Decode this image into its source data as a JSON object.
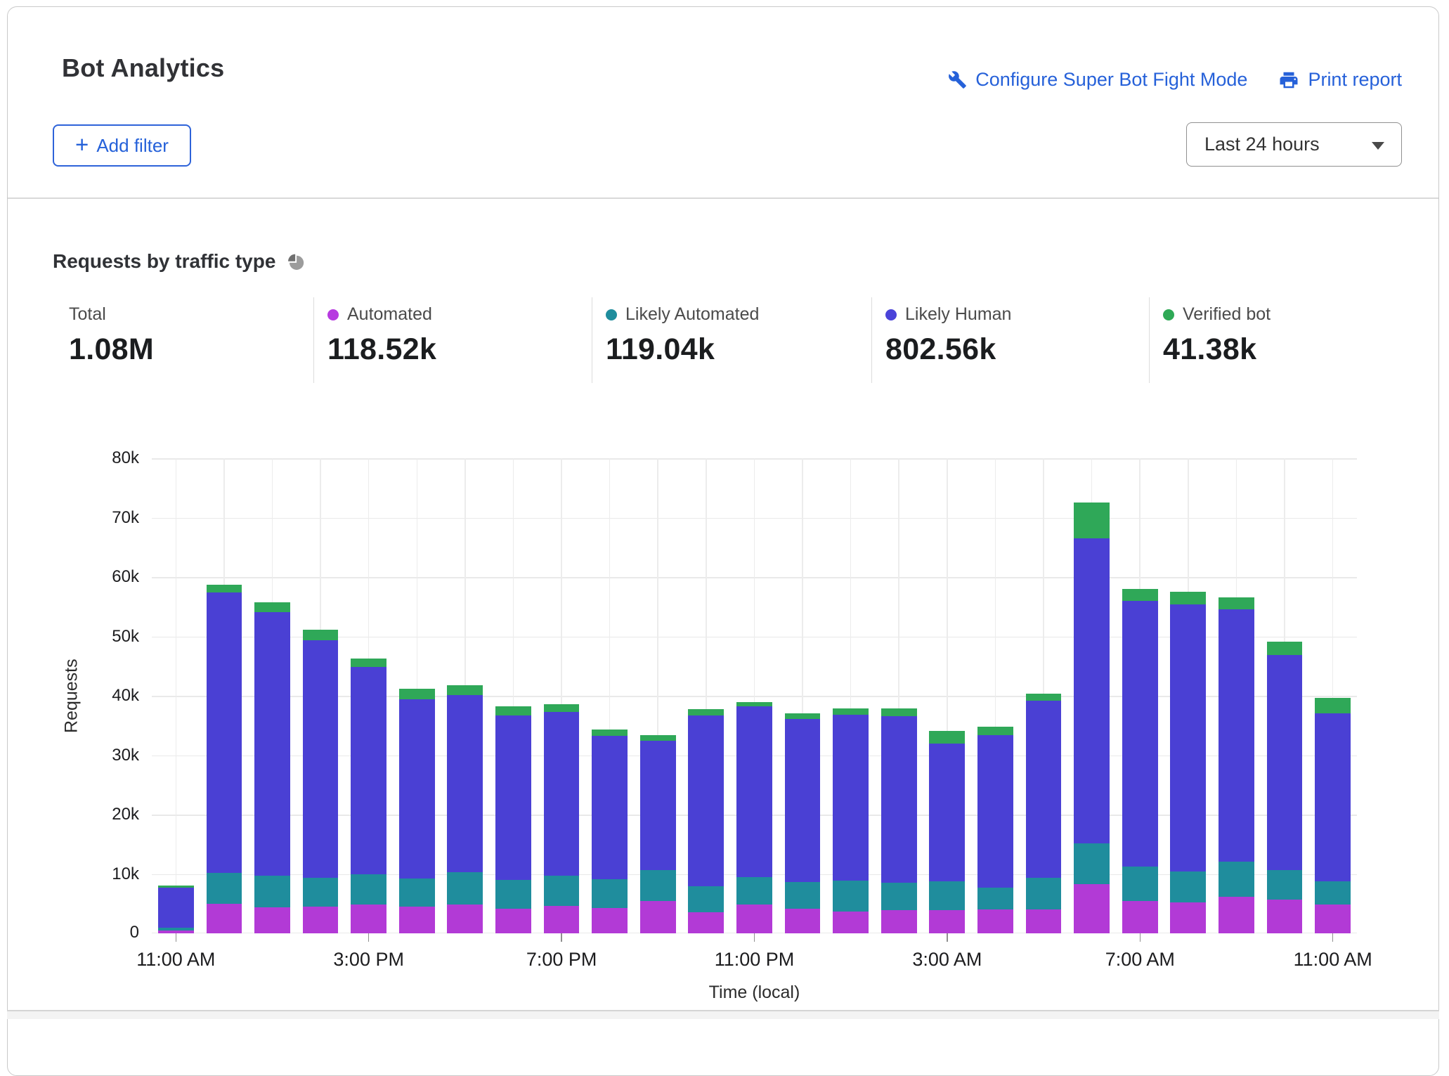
{
  "header": {
    "title": "Bot Analytics",
    "configure_link": "Configure Super Bot Fight Mode",
    "print_link": "Print report",
    "plus": "+",
    "add_filter": "Add filter",
    "time_range": "Last 24 hours",
    "link_color": "#2661d9"
  },
  "section": {
    "title": "Requests by traffic type"
  },
  "stats": [
    {
      "label": "Total",
      "value": "1.08M"
    },
    {
      "label": "Automated",
      "value": "118.52k",
      "color": "#b73ae0"
    },
    {
      "label": "Likely Automated",
      "value": "119.04k",
      "color": "#1f8d9d"
    },
    {
      "label": "Likely Human",
      "value": "802.56k",
      "color": "#4a43d9"
    },
    {
      "label": "Verified bot",
      "value": "41.38k",
      "color": "#2fa956"
    }
  ],
  "chart_data": {
    "type": "bar",
    "stacked": true,
    "title": "Requests by traffic type",
    "xlabel": "Time (local)",
    "ylabel": "Requests",
    "ylim": [
      0,
      80000
    ],
    "grid": true,
    "legend_position": "top-stats-row",
    "y_ticks": [
      "0",
      "10k",
      "20k",
      "30k",
      "40k",
      "50k",
      "60k",
      "70k",
      "80k"
    ],
    "categories": [
      "11:00 AM",
      "12:00 PM",
      "1:00 PM",
      "2:00 PM",
      "3:00 PM",
      "4:00 PM",
      "5:00 PM",
      "6:00 PM",
      "7:00 PM",
      "8:00 PM",
      "9:00 PM",
      "10:00 PM",
      "11:00 PM",
      "12:00 AM",
      "1:00 AM",
      "2:00 AM",
      "3:00 AM",
      "4:00 AM",
      "5:00 AM",
      "6:00 AM",
      "7:00 AM",
      "8:00 AM",
      "9:00 AM",
      "10:00 AM",
      "11:00 AM"
    ],
    "x_ticks": [
      {
        "index": 0,
        "label": "11:00 AM"
      },
      {
        "index": 4,
        "label": "3:00 PM"
      },
      {
        "index": 8,
        "label": "7:00 PM"
      },
      {
        "index": 12,
        "label": "11:00 PM"
      },
      {
        "index": 16,
        "label": "3:00 AM"
      },
      {
        "index": 20,
        "label": "7:00 AM"
      },
      {
        "index": 24,
        "label": "11:00 AM"
      }
    ],
    "series": [
      {
        "name": "Automated",
        "color": "#b23ad6",
        "values": [
          500,
          5000,
          4400,
          4500,
          4800,
          4500,
          4900,
          4200,
          4600,
          4250,
          5400,
          3600,
          4800,
          4200,
          3700,
          3900,
          3900,
          4000,
          4000,
          8300,
          5400,
          5200,
          6200,
          5700,
          4800
        ]
      },
      {
        "name": "Likely Automated",
        "color": "#1f8d9d",
        "values": [
          500,
          5200,
          5300,
          4900,
          5200,
          4700,
          5450,
          4800,
          5100,
          4850,
          5200,
          4300,
          4700,
          4500,
          5200,
          4600,
          4900,
          3700,
          5300,
          6800,
          5900,
          5200,
          5900,
          5000,
          4000
        ]
      },
      {
        "name": "Likely Human",
        "color": "#4a40d4",
        "values": [
          6700,
          47200,
          44400,
          39900,
          34900,
          30200,
          29750,
          27700,
          27600,
          24200,
          21800,
          28800,
          28700,
          27400,
          27900,
          28100,
          23200,
          25700,
          29900,
          51400,
          44700,
          45000,
          42500,
          36200,
          28200
        ]
      },
      {
        "name": "Verified bot",
        "color": "#2fa858",
        "values": [
          300,
          1300,
          1700,
          1800,
          1400,
          1800,
          1700,
          1500,
          1300,
          1000,
          1000,
          1100,
          800,
          1000,
          1100,
          1300,
          2100,
          1400,
          1200,
          6000,
          2000,
          2100,
          2000,
          2200,
          2600
        ]
      }
    ],
    "displayed_totals": {
      "total": "1.08M",
      "automated": "118.52k",
      "likely_automated": "119.04k",
      "likely_human": "802.56k",
      "verified_bot": "41.38k"
    }
  }
}
